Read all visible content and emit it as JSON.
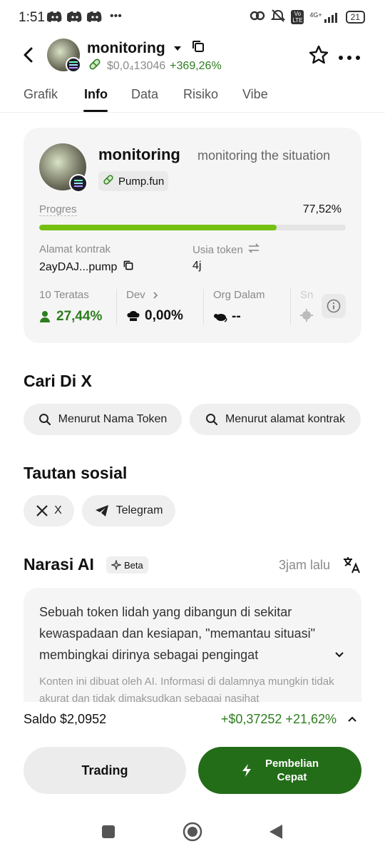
{
  "status_bar": {
    "time": "1:51",
    "dots": "•••",
    "network": "4G+",
    "volte": "Vo LTE",
    "battery": "21"
  },
  "header": {
    "token_name": "monitoring",
    "price": "$0,0₄13046",
    "change": "+369,26%"
  },
  "tabs": [
    "Grafik",
    "Info",
    "Data",
    "Risiko",
    "Vibe"
  ],
  "active_tab": "Info",
  "card": {
    "name": "monitoring",
    "description": "monitoring the situation",
    "platform": "Pump.fun",
    "progress_label": "Progres",
    "progress_value": "77,52%",
    "progress_fraction": 0.7752,
    "contract_label": "Alamat kontrak",
    "contract_value": "2ayDAJ...pump",
    "age_label": "Usia token",
    "age_value": "4j",
    "stats": [
      {
        "label": "10 Teratas",
        "value": "27,44%"
      },
      {
        "label": "Dev",
        "value": "0,00%"
      },
      {
        "label": "Org Dalam",
        "value": "--"
      },
      {
        "label": "Sn",
        "value": ""
      }
    ]
  },
  "search_x": {
    "title": "Cari Di X",
    "by_name": "Menurut Nama Token",
    "by_contract": "Menurut alamat kontrak"
  },
  "social": {
    "title": "Tautan sosial",
    "x": "X",
    "telegram": "Telegram"
  },
  "ai": {
    "title": "Narasi AI",
    "beta": "Beta",
    "time": "3jam lalu",
    "text": "Sebuah token lidah yang dibangun di sekitar kewaspadaan dan kesiapan, \"memantau situasi\" membingkai dirinya sebagai pengingat",
    "note": "Konten ini dibuat oleh AI. Informasi di dalamnya mungkin tidak akurat dan tidak dimaksudkan sebagai nasihat"
  },
  "footer": {
    "saldo": "Saldo $2,0952",
    "pnl": "+$0,37252 +21,62%",
    "trade_label": "Trading",
    "buy_label_1": "Pembelian",
    "buy_label_2": "Cepat"
  },
  "colors": {
    "green_text": "#2e7d1f",
    "progress_fill": "#76c013",
    "buy_button": "#236d18"
  }
}
